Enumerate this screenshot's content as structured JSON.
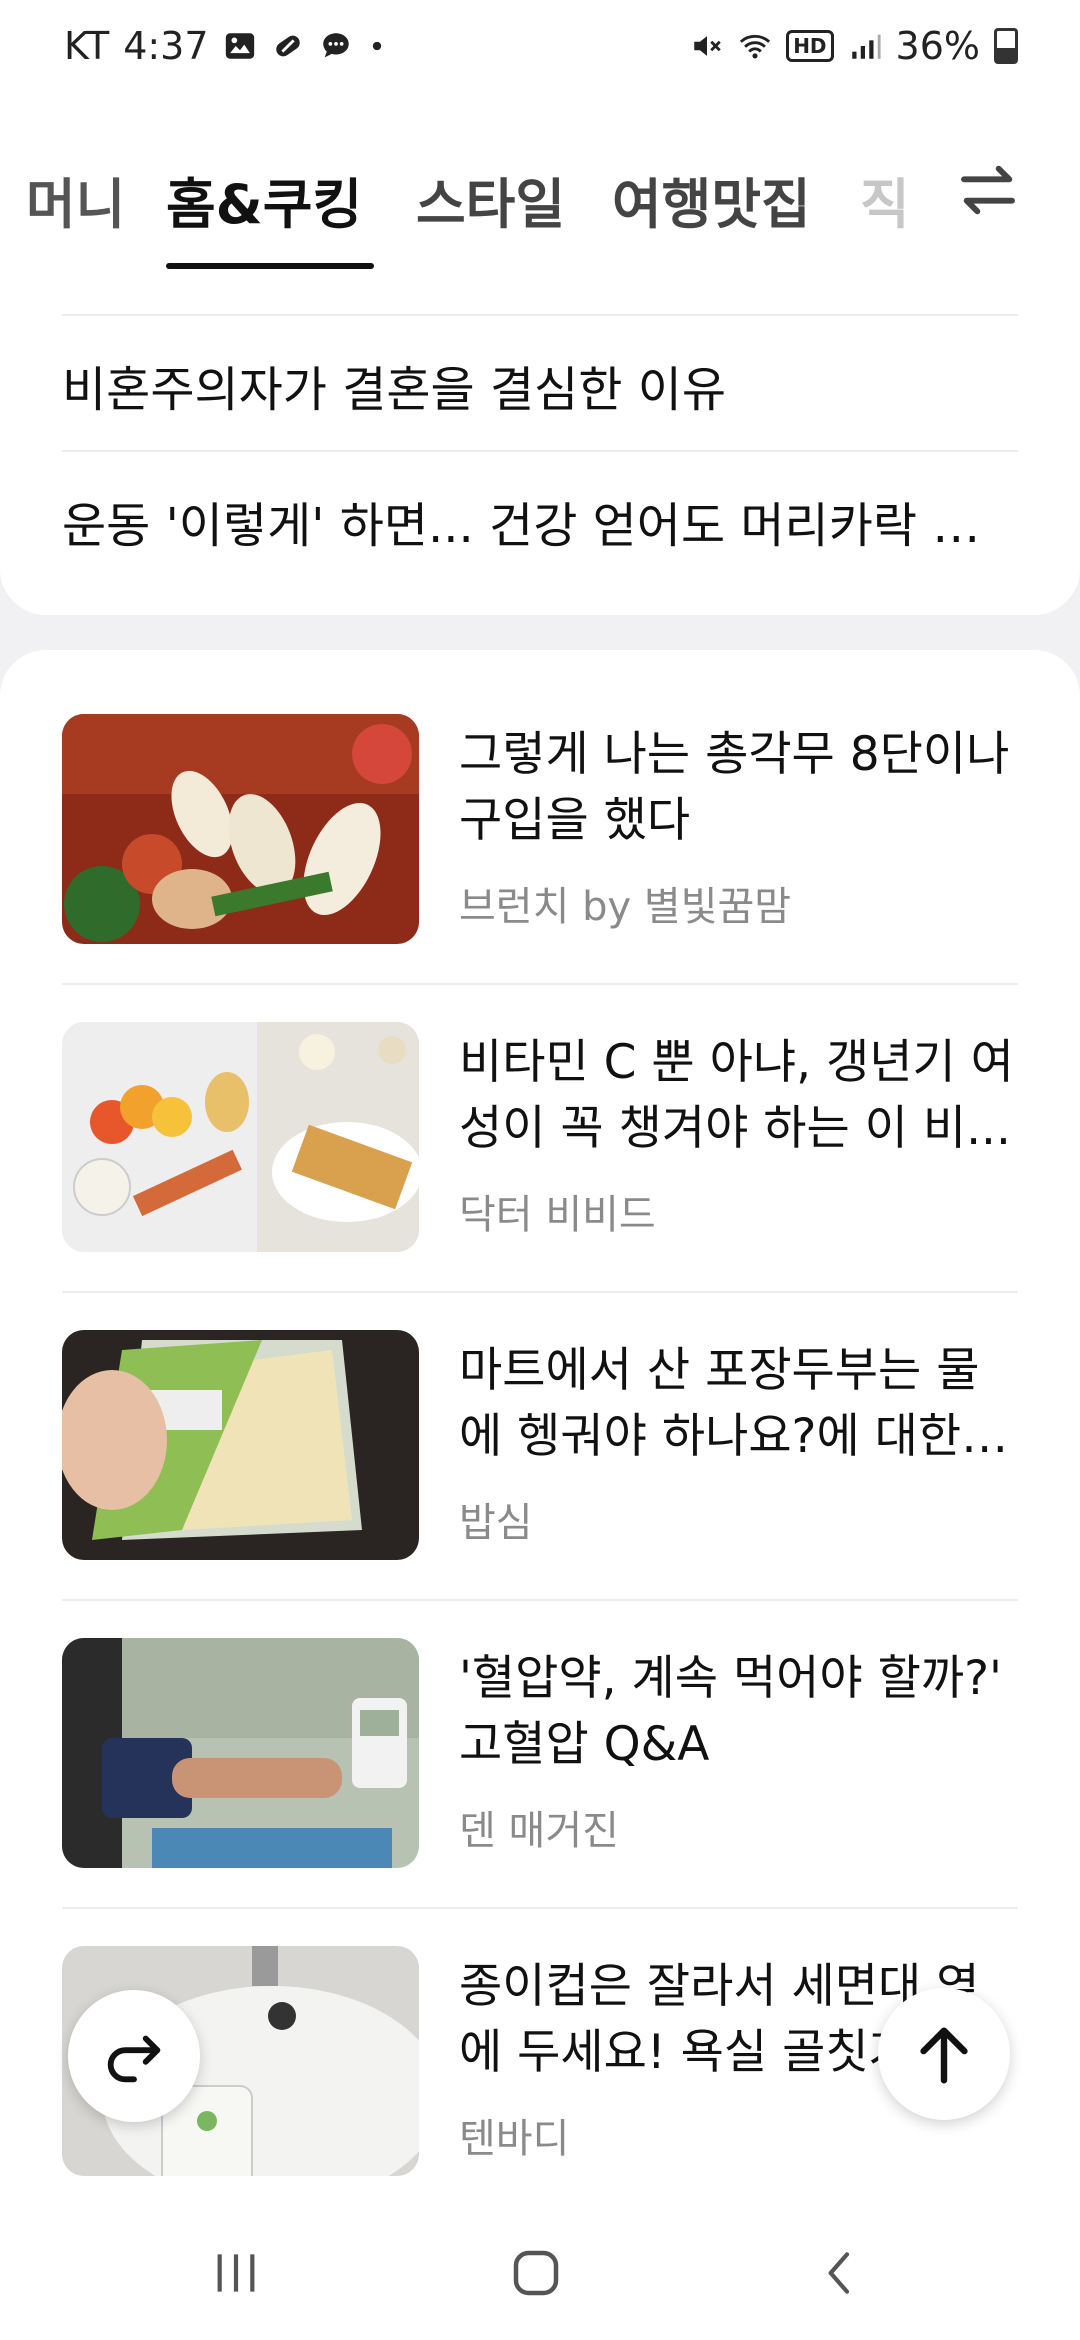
{
  "status_bar": {
    "carrier": "KT",
    "time": "4:37",
    "battery": "36%",
    "hd_label": "HD",
    "icons": [
      "gallery-icon",
      "link-icon",
      "chat-icon",
      "dot-icon",
      "mute-icon",
      "wifi-icon",
      "signal-icon",
      "battery-icon"
    ]
  },
  "tabs": {
    "items": [
      {
        "label": "머니"
      },
      {
        "label": "홈&쿠킹"
      },
      {
        "label": "스타일"
      },
      {
        "label": "여행맛집"
      },
      {
        "label": "직"
      }
    ],
    "active_index": 1
  },
  "headlines": [
    {
      "text": "비혼주의자가 결혼을 결심한 이유"
    },
    {
      "text": "운동 '이렇게' 하면... 건강 얻어도 머리카락 잃는..."
    }
  ],
  "articles": [
    {
      "title": "그렇게 나는 총각무 8단이나 구입을 했다",
      "source": "브런치 by 별빛꿈맘"
    },
    {
      "title": "비타민 C 뿐 아냐, 갱년기 여성이 꼭 챙겨야 하는 이 비...",
      "source": "닥터 비비드"
    },
    {
      "title": "마트에서 산 포장두부는 물에 헹궈야 하나요?에 대한 ...",
      "source": "밥심"
    },
    {
      "title": "'혈압약, 계속 먹어야 할까?' 고혈압 Q&A",
      "source": "덴 매거진"
    },
    {
      "title": "종이컵은 잘라서 세면대 옆에 두세요! 욕실 골칫거",
      "source": "텐바디"
    }
  ],
  "colors": {
    "accent": "#111111",
    "background": "#f1f1f4",
    "source_text": "#8a8a8a"
  }
}
